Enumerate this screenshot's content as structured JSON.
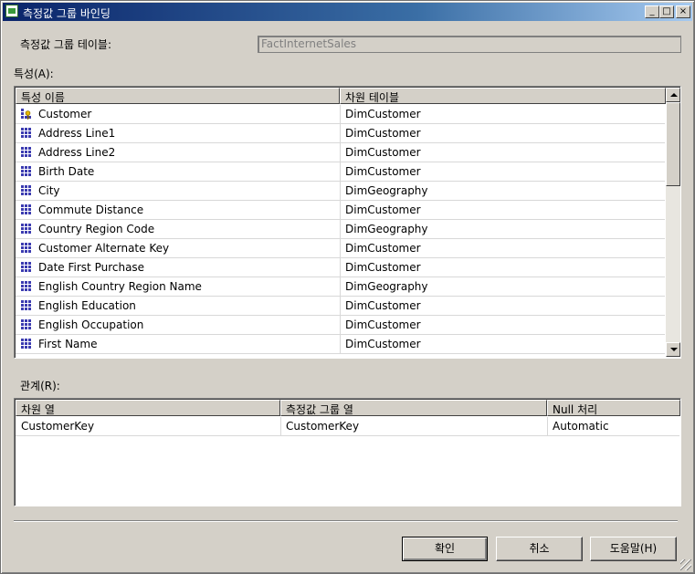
{
  "window": {
    "title": "측정값 그룹 바인딩",
    "min_glyph": "_",
    "max_glyph": "□",
    "close_glyph": "×"
  },
  "measure_group_table": {
    "label": "측정값 그룹 테이블:",
    "value": "FactInternetSales"
  },
  "attributes": {
    "label": "특성(A):",
    "columns": [
      "특성 이름",
      "차원 테이블"
    ],
    "rows": [
      {
        "name": "Customer",
        "table": "DimCustomer",
        "icon": "key-attribute-icon"
      },
      {
        "name": "Address Line1",
        "table": "DimCustomer",
        "icon": "attribute-icon"
      },
      {
        "name": "Address Line2",
        "table": "DimCustomer",
        "icon": "attribute-icon"
      },
      {
        "name": "Birth Date",
        "table": "DimCustomer",
        "icon": "attribute-icon"
      },
      {
        "name": "City",
        "table": "DimGeography",
        "icon": "attribute-icon"
      },
      {
        "name": "Commute Distance",
        "table": "DimCustomer",
        "icon": "attribute-icon"
      },
      {
        "name": "Country Region Code",
        "table": "DimGeography",
        "icon": "attribute-icon"
      },
      {
        "name": "Customer Alternate Key",
        "table": "DimCustomer",
        "icon": "attribute-icon"
      },
      {
        "name": "Date First Purchase",
        "table": "DimCustomer",
        "icon": "attribute-icon"
      },
      {
        "name": "English Country Region Name",
        "table": "DimGeography",
        "icon": "attribute-icon"
      },
      {
        "name": "English Education",
        "table": "DimCustomer",
        "icon": "attribute-icon"
      },
      {
        "name": "English Occupation",
        "table": "DimCustomer",
        "icon": "attribute-icon"
      },
      {
        "name": "First Name",
        "table": "DimCustomer",
        "icon": "attribute-icon"
      }
    ]
  },
  "relationships": {
    "label": "관계(R):",
    "columns": [
      "차원 열",
      "측정값 그룹 열",
      "Null 처리"
    ],
    "rows": [
      {
        "dim_col": "CustomerKey",
        "mg_col": "CustomerKey",
        "null_proc": "Automatic"
      }
    ]
  },
  "buttons": {
    "ok": "확인",
    "cancel": "취소",
    "help": "도움말(H)"
  },
  "colors": {
    "titlebar_start": "#0a246a",
    "dialog_bg": "#d4d0c8"
  }
}
